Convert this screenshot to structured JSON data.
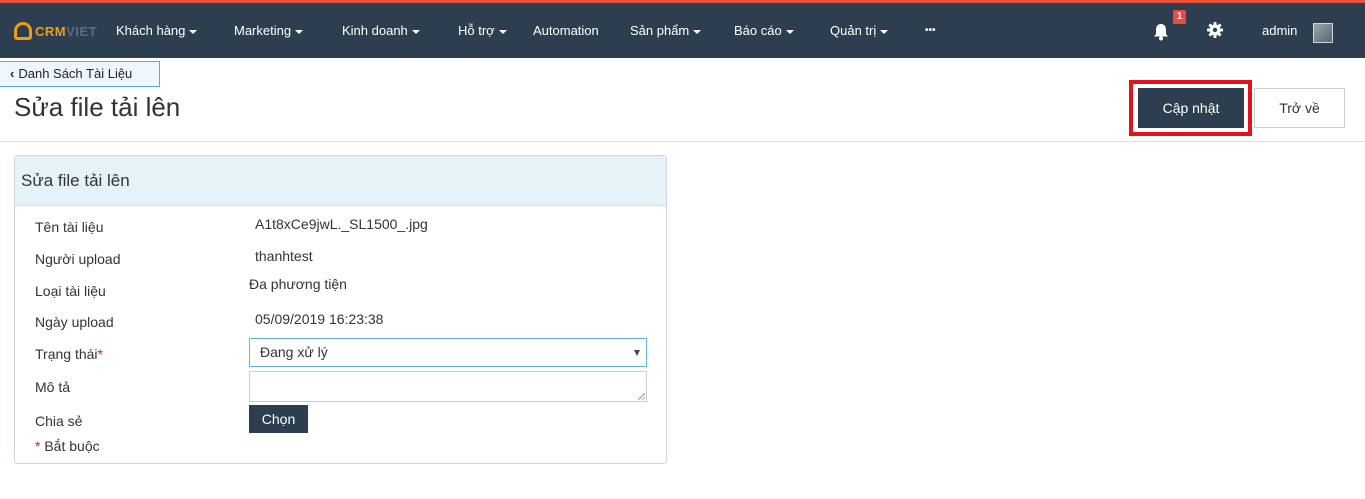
{
  "brand": {
    "logo_part1": "CRM",
    "logo_part2": "VIET"
  },
  "nav": {
    "items": [
      {
        "label": "Khách hàng",
        "caret": true
      },
      {
        "label": "Marketing",
        "caret": true
      },
      {
        "label": "Kinh doanh",
        "caret": true
      },
      {
        "label": "Hỗ trợ",
        "caret": true
      },
      {
        "label": "Automation",
        "caret": false
      },
      {
        "label": "Sản phẩm",
        "caret": true
      },
      {
        "label": "Báo cáo",
        "caret": true
      },
      {
        "label": "Quản trị",
        "caret": true
      },
      {
        "label": "•••",
        "caret": false
      }
    ],
    "notification_count": "1",
    "user_name": "admin"
  },
  "header": {
    "back_link": "Danh Sách Tài Liệu",
    "title": "Sửa file tải lên",
    "update_button": "Cập nhật",
    "back_button": "Trở về"
  },
  "form": {
    "panel_title": "Sửa file tải lên",
    "fields": {
      "doc_name_label": "Tên tài liệu",
      "doc_name_value": "A1t8xCe9jwL._SL1500_.jpg",
      "uploader_label": "Người upload",
      "uploader_value": "thanhtest",
      "doc_type_label": "Loại tài liệu",
      "doc_type_value": "Đa phương tiện",
      "upload_date_label": "Ngày upload",
      "upload_date_value": "05/09/2019 16:23:38",
      "status_label": "Trạng thái",
      "status_value": "Đang xử lý",
      "description_label": "Mô tả",
      "description_value": "",
      "share_label": "Chia sẻ",
      "choose_button": "Chọn",
      "required_marker": "*",
      "required_note": "Bắt buộc"
    }
  },
  "colors": {
    "topbar": "#2c3e50",
    "accent": "#f39c12",
    "highlight": "#e0131e",
    "panel_head": "#e5f3f8"
  }
}
